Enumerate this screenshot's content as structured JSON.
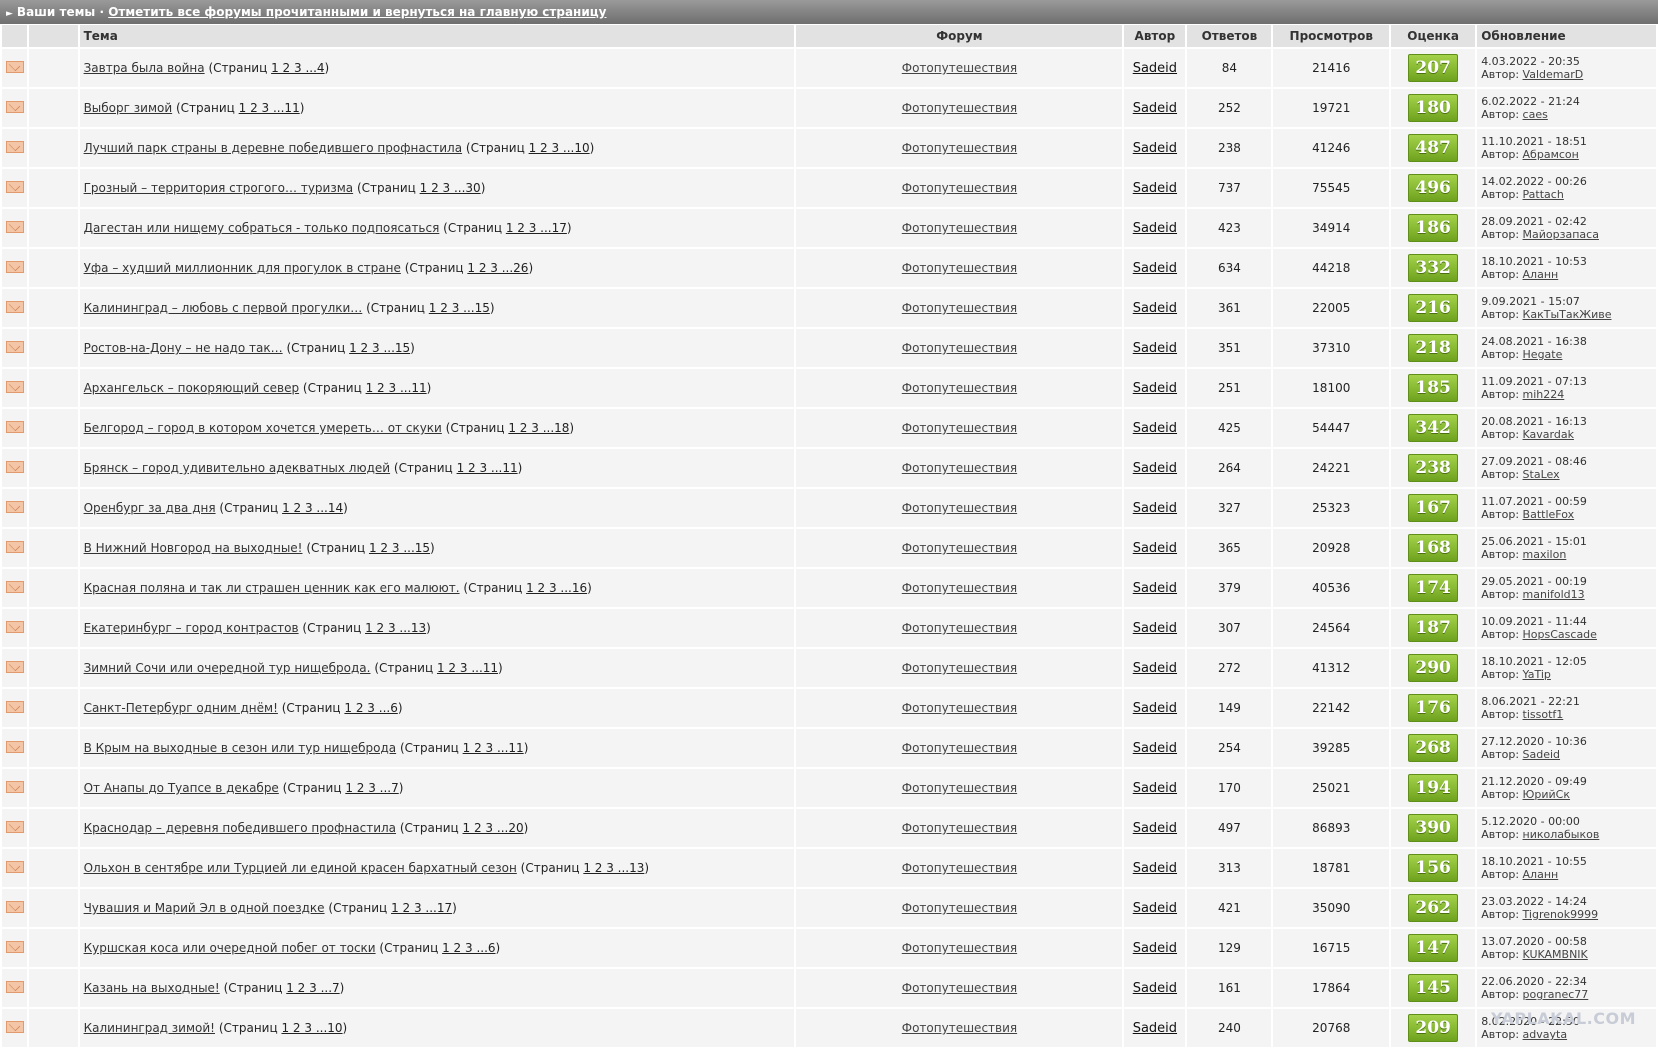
{
  "topbar": {
    "title": "Ваши темы",
    "separator": "·",
    "mark_read_link": "Отметить все форумы прочитанными и вернуться на главную страницу"
  },
  "columns": {
    "topic": "Тема",
    "forum": "Форум",
    "author": "Автор",
    "replies": "Ответов",
    "views": "Просмотров",
    "rating": "Оценка",
    "updated": "Обновление"
  },
  "labels": {
    "pages_prefix": "(Страниц",
    "pages_suffix": ")",
    "author_prefix": "Автор:"
  },
  "rows": [
    {
      "title": "Завтра была война",
      "pages": "1 2 3 ...4",
      "forum": "Фотопутешествия",
      "author": "Sadeid",
      "replies": "84",
      "views": "21416",
      "rating": "207",
      "date": "4.03.2022 - 20:35",
      "last_author": "ValdemarD"
    },
    {
      "title": "Выборг зимой",
      "pages": "1 2 3 ...11",
      "forum": "Фотопутешествия",
      "author": "Sadeid",
      "replies": "252",
      "views": "19721",
      "rating": "180",
      "date": "6.02.2022 - 21:24",
      "last_author": "caes"
    },
    {
      "title": "Лучший парк страны в деревне победившего профнастила",
      "pages": "1 2 3 ...10",
      "forum": "Фотопутешествия",
      "author": "Sadeid",
      "replies": "238",
      "views": "41246",
      "rating": "487",
      "date": "11.10.2021 - 18:51",
      "last_author": "Абрамсон"
    },
    {
      "title": "Грозный – территория строгого… туризма",
      "pages": "1 2 3 ...30",
      "forum": "Фотопутешествия",
      "author": "Sadeid",
      "replies": "737",
      "views": "75545",
      "rating": "496",
      "date": "14.02.2022 - 00:26",
      "last_author": "Pattach"
    },
    {
      "title": "Дагестан или нищему собраться - только подпоясаться",
      "pages": "1 2 3 ...17",
      "forum": "Фотопутешествия",
      "author": "Sadeid",
      "replies": "423",
      "views": "34914",
      "rating": "186",
      "date": "28.09.2021 - 02:42",
      "last_author": "Майорзапаса"
    },
    {
      "title": "Уфа – худший миллионник для прогулок в стране",
      "pages": "1 2 3 ...26",
      "forum": "Фотопутешествия",
      "author": "Sadeid",
      "replies": "634",
      "views": "44218",
      "rating": "332",
      "date": "18.10.2021 - 10:53",
      "last_author": "Аланн"
    },
    {
      "title": "Калининград – любовь с первой прогулки…",
      "pages": "1 2 3 ...15",
      "forum": "Фотопутешествия",
      "author": "Sadeid",
      "replies": "361",
      "views": "22005",
      "rating": "216",
      "date": "9.09.2021 - 15:07",
      "last_author": "КакТыТакЖиве"
    },
    {
      "title": "Ростов-на-Дону – не надо так…",
      "pages": "1 2 3 ...15",
      "forum": "Фотопутешествия",
      "author": "Sadeid",
      "replies": "351",
      "views": "37310",
      "rating": "218",
      "date": "24.08.2021 - 16:38",
      "last_author": "Hegate"
    },
    {
      "title": "Архангельск – покоряющий север",
      "pages": "1 2 3 ...11",
      "forum": "Фотопутешествия",
      "author": "Sadeid",
      "replies": "251",
      "views": "18100",
      "rating": "185",
      "date": "11.09.2021 - 07:13",
      "last_author": "mih224"
    },
    {
      "title": "Белгород – город в котором хочется умереть… от скуки",
      "pages": "1 2 3 ...18",
      "forum": "Фотопутешествия",
      "author": "Sadeid",
      "replies": "425",
      "views": "54447",
      "rating": "342",
      "date": "20.08.2021 - 16:13",
      "last_author": "Kavardak"
    },
    {
      "title": "Брянск – город удивительно адекватных людей",
      "pages": "1 2 3 ...11",
      "forum": "Фотопутешествия",
      "author": "Sadeid",
      "replies": "264",
      "views": "24221",
      "rating": "238",
      "date": "27.09.2021 - 08:46",
      "last_author": "StaLex"
    },
    {
      "title": "Оренбург за два дня",
      "pages": "1 2 3 ...14",
      "forum": "Фотопутешествия",
      "author": "Sadeid",
      "replies": "327",
      "views": "25323",
      "rating": "167",
      "date": "11.07.2021 - 00:59",
      "last_author": "BattleFox"
    },
    {
      "title": "В Нижний Новгород на выходные!",
      "pages": "1 2 3 ...15",
      "forum": "Фотопутешествия",
      "author": "Sadeid",
      "replies": "365",
      "views": "20928",
      "rating": "168",
      "date": "25.06.2021 - 15:01",
      "last_author": "maxilon"
    },
    {
      "title": "Красная поляна и так ли страшен ценник как его малюют.",
      "pages": "1 2 3 ...16",
      "forum": "Фотопутешествия",
      "author": "Sadeid",
      "replies": "379",
      "views": "40536",
      "rating": "174",
      "date": "29.05.2021 - 00:19",
      "last_author": "manifold13"
    },
    {
      "title": "Екатеринбург – город контрастов",
      "pages": "1 2 3 ...13",
      "forum": "Фотопутешествия",
      "author": "Sadeid",
      "replies": "307",
      "views": "24564",
      "rating": "187",
      "date": "10.09.2021 - 11:44",
      "last_author": "HopsCascade"
    },
    {
      "title": "Зимний Сочи или очередной тур нищеброда.",
      "pages": "1 2 3 ...11",
      "forum": "Фотопутешествия",
      "author": "Sadeid",
      "replies": "272",
      "views": "41312",
      "rating": "290",
      "date": "18.10.2021 - 12:05",
      "last_author": "YaTip"
    },
    {
      "title": "Санкт-Петербург одним днём!",
      "pages": "1 2 3 ...6",
      "forum": "Фотопутешествия",
      "author": "Sadeid",
      "replies": "149",
      "views": "22142",
      "rating": "176",
      "date": "8.06.2021 - 22:21",
      "last_author": "tissotf1"
    },
    {
      "title": "В Крым на выходные в сезон или тур нищеброда",
      "pages": "1 2 3 ...11",
      "forum": "Фотопутешествия",
      "author": "Sadeid",
      "replies": "254",
      "views": "39285",
      "rating": "268",
      "date": "27.12.2020 - 10:36",
      "last_author": "Sadeid"
    },
    {
      "title": "От Анапы до Туапсе в декабре",
      "pages": "1 2 3 ...7",
      "forum": "Фотопутешествия",
      "author": "Sadeid",
      "replies": "170",
      "views": "25021",
      "rating": "194",
      "date": "21.12.2020 - 09:49",
      "last_author": "ЮрийСк"
    },
    {
      "title": "Краснодар – деревня победившего профнастила",
      "pages": "1 2 3 ...20",
      "forum": "Фотопутешествия",
      "author": "Sadeid",
      "replies": "497",
      "views": "86893",
      "rating": "390",
      "date": "5.12.2020 - 00:00",
      "last_author": "николабыков"
    },
    {
      "title": "Ольхон в сентябре или Турцией ли единой красен бархатный сезон",
      "pages": "1 2 3 ...13",
      "forum": "Фотопутешествия",
      "author": "Sadeid",
      "replies": "313",
      "views": "18781",
      "rating": "156",
      "date": "18.10.2021 - 10:55",
      "last_author": "Аланн"
    },
    {
      "title": "Чувашия и Марий Эл в одной поездке",
      "pages": "1 2 3 ...17",
      "forum": "Фотопутешествия",
      "author": "Sadeid",
      "replies": "421",
      "views": "35090",
      "rating": "262",
      "date": "23.03.2022 - 14:24",
      "last_author": "Tigrenok9999"
    },
    {
      "title": "Куршская коса или очередной побег от тоски",
      "pages": "1 2 3 ...6",
      "forum": "Фотопутешествия",
      "author": "Sadeid",
      "replies": "129",
      "views": "16715",
      "rating": "147",
      "date": "13.07.2020 - 00:58",
      "last_author": "KUKAMBNIK"
    },
    {
      "title": "Казань на выходные!",
      "pages": "1 2 3 ...7",
      "forum": "Фотопутешествия",
      "author": "Sadeid",
      "replies": "161",
      "views": "17864",
      "rating": "145",
      "date": "22.06.2020 - 22:34",
      "last_author": "pogranec77"
    },
    {
      "title": "Калининград зимой!",
      "pages": "1 2 3 ...10",
      "forum": "Фотопутешествия",
      "author": "Sadeid",
      "replies": "240",
      "views": "20768",
      "rating": "209",
      "date": "8.02.2020 - 22:50",
      "last_author": "advayta"
    }
  ],
  "watermark": "YAPLAKAL.COM"
}
